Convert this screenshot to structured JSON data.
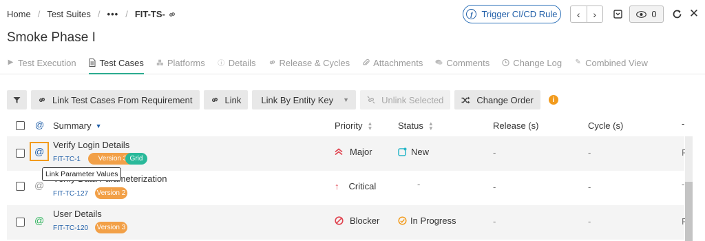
{
  "breadcrumb": {
    "home": "Home",
    "suites": "Test Suites",
    "more": "•••",
    "current": "FIT-TS-"
  },
  "header": {
    "ci_button": "Trigger CI/CD Rule",
    "watch_count": "0",
    "title": "Smoke Phase I"
  },
  "tabs": [
    {
      "label": "Test Execution",
      "icon": "play-circle-icon"
    },
    {
      "label": "Test Cases",
      "icon": "document-icon"
    },
    {
      "label": "Platforms",
      "icon": "cubes-icon"
    },
    {
      "label": "Details",
      "icon": "info-circle-icon"
    },
    {
      "label": "Release & Cycles",
      "icon": "link-icon"
    },
    {
      "label": "Attachments",
      "icon": "paperclip-icon"
    },
    {
      "label": "Comments",
      "icon": "comments-icon"
    },
    {
      "label": "Change Log",
      "icon": "clock-icon"
    },
    {
      "label": "Combined View",
      "icon": "pencil-icon"
    }
  ],
  "toolbar": {
    "link_from_req": "Link Test Cases From Requirement",
    "link": "Link",
    "link_by_key": "Link By Entity Key",
    "unlink": "Unlink Selected",
    "change_order": "Change Order"
  },
  "table": {
    "headers": {
      "at": "@",
      "summary": "Summary",
      "priority": "Priority",
      "status": "Status",
      "release": "Release (s)",
      "cycle": "Cycle (s)",
      "extra": "-"
    },
    "rows": [
      {
        "title": "Verify Login Details",
        "id": "FIT-TC-1",
        "version": "Version 3",
        "grid": "Grid",
        "priority": "Major",
        "status": "New",
        "release": "-",
        "cycle": "-",
        "extra": "F",
        "at_color": "#1f5ea8"
      },
      {
        "title": "Verify Data Parameterization",
        "id": "FIT-TC-127",
        "version": "Version 2",
        "grid": "",
        "priority": "Critical",
        "status": "-",
        "release": "-",
        "cycle": "-",
        "extra": "-",
        "at_color": "#999999"
      },
      {
        "title": "User Details",
        "id": "FIT-TC-120",
        "version": "Version 3",
        "grid": "",
        "priority": "Blocker",
        "status": "In Progress",
        "release": "-",
        "cycle": "-",
        "extra": "F",
        "at_color": "#2bb35a"
      }
    ]
  },
  "tooltip": "Link Parameter Values",
  "colors": {
    "accent": "#2bab8f",
    "brand_blue": "#1f5ea8",
    "orange": "#f29b1d"
  }
}
